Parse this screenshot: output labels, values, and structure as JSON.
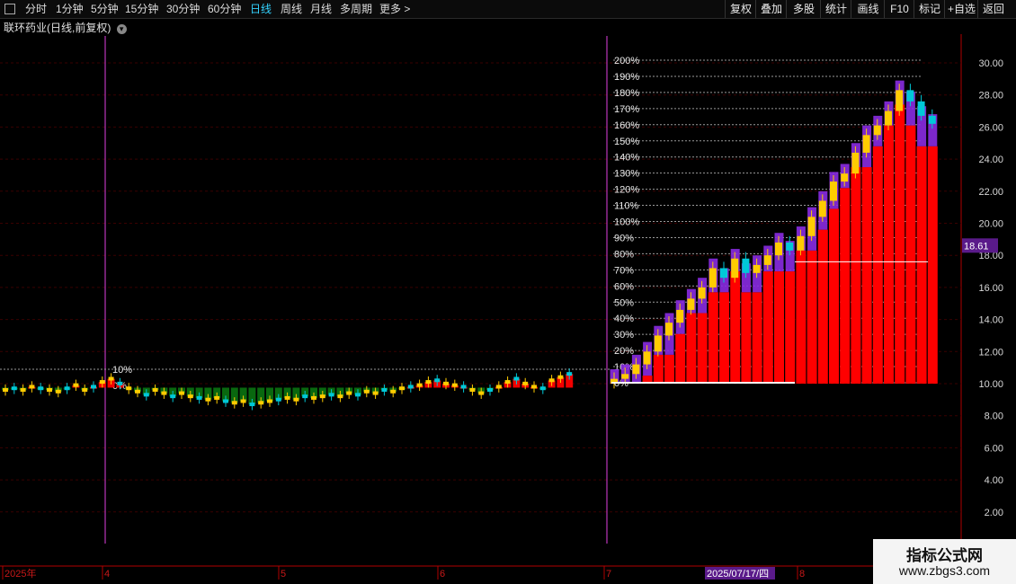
{
  "toolbar": {
    "periods": [
      "分时",
      "1分钟",
      "5分钟",
      "15分钟",
      "30分钟",
      "60分钟",
      "日线",
      "周线",
      "月线",
      "多周期",
      "更多 >"
    ],
    "active_period": "日线",
    "right_buttons": [
      "复权",
      "叠加",
      "多股",
      "统计",
      "画线",
      "F10",
      "标记",
      "+自选",
      "返回"
    ]
  },
  "stock": {
    "name": "联环药业",
    "title_suffix": "(日线,前复权)"
  },
  "colors": {
    "up": "#ff0000",
    "down": "#00c8d8",
    "candle_up": "#ffcc00",
    "purple": "#8a2be2",
    "dark_green": "#0a6e10",
    "axis": "#b00000",
    "grid": "#3a0000",
    "vline": "#e040e0",
    "price_tag": "#5a1a8a"
  },
  "price_axis": {
    "ticks": [
      "30.00",
      "28.00",
      "26.00",
      "24.00",
      "22.00",
      "20.00",
      "18.00",
      "16.00",
      "14.00",
      "12.00",
      "10.00",
      "8.00",
      "6.00",
      "4.00",
      "2.00"
    ],
    "current": "18.61"
  },
  "pct_levels_right": [
    "200%",
    "190%",
    "180%",
    "170%",
    "160%",
    "150%",
    "140%",
    "130%",
    "120%",
    "110%",
    "100%",
    "90%",
    "80%",
    "70%",
    "60%",
    "50%",
    "40%",
    "30%",
    "20%",
    "10%",
    "0%"
  ],
  "pct_levels_left": [
    "10%",
    "0%"
  ],
  "date_axis": {
    "labels": [
      "2025年",
      "4",
      "5",
      "6",
      "7",
      "8"
    ],
    "highlight": "2025/07/17/四"
  },
  "watermark": {
    "line1": "指标公式网",
    "line2": "www.zbgs3.com"
  },
  "chart_data": {
    "type": "candlestick",
    "ylim": [
      0,
      32
    ],
    "closes_recent": [
      10.3,
      10.6,
      11.2,
      12.0,
      13.0,
      13.8,
      14.6,
      15.3,
      16.0,
      17.2,
      16.6,
      17.8,
      16.9,
      17.4,
      18.0,
      18.8,
      18.3,
      19.2,
      20.4,
      21.4,
      22.6,
      23.1,
      24.4,
      25.5,
      26.1,
      27.0,
      28.3,
      27.6,
      26.7,
      26.2
    ],
    "current_price": 18.61
  }
}
